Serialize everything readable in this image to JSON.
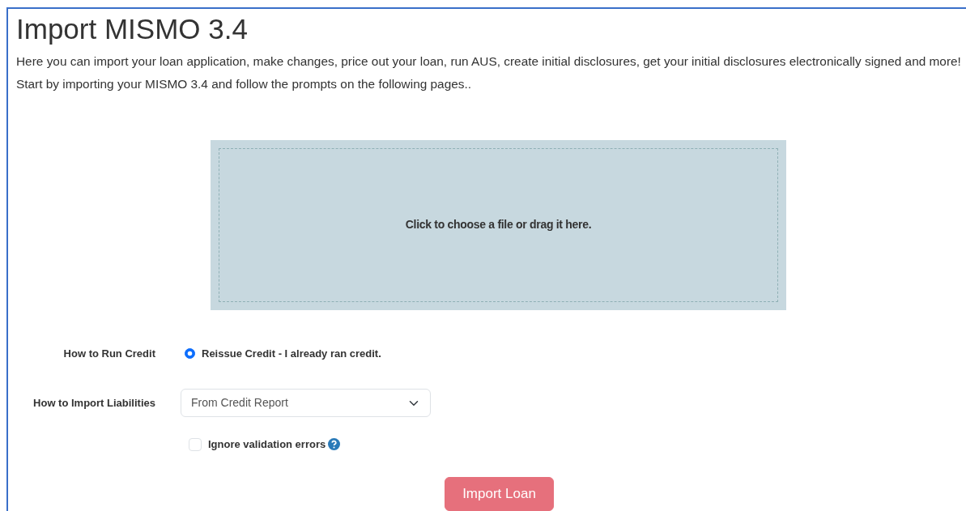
{
  "title": "Import MISMO 3.4",
  "intro": "Here you can import your loan application, make changes, price out your loan, run AUS, create initial disclosures, get your initial disclosures electronically signed and more! Start by importing your MISMO 3.4 and follow the prompts on the following pages..",
  "dropzone": {
    "text": "Click to choose a file or drag it here."
  },
  "credit": {
    "label": "How to Run Credit",
    "options": [
      {
        "label": "Reissue Credit - I already ran credit.",
        "selected": true
      }
    ]
  },
  "liabilities": {
    "label": "How to Import Liabilities",
    "value": "From Credit Report"
  },
  "ignore_errors": {
    "label": "Ignore validation errors",
    "checked": false
  },
  "submit": {
    "label": "Import Loan",
    "disabled": true
  }
}
